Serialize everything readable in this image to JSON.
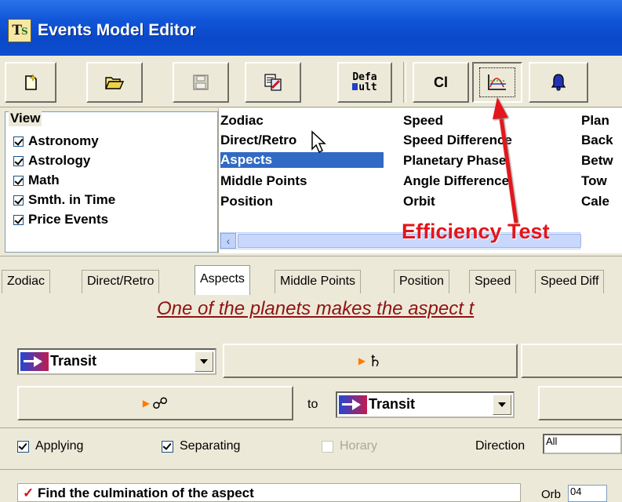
{
  "window": {
    "title": "Events Model Editor",
    "icon_text": "TS"
  },
  "toolbar": {
    "buttons": [
      {
        "name": "new-icon"
      },
      {
        "name": "open-folder-icon"
      },
      {
        "name": "save-icon"
      },
      {
        "name": "copy-icon"
      },
      {
        "name": "default-button",
        "label_top": "Defa",
        "label_bottom": "ult"
      },
      {
        "name": "cl-button",
        "label": "Cl"
      },
      {
        "name": "efficiency-test-icon"
      },
      {
        "name": "bell-icon"
      }
    ]
  },
  "view": {
    "legend": "View",
    "items": [
      {
        "label": "Astronomy",
        "checked": true
      },
      {
        "label": "Astrology",
        "checked": true
      },
      {
        "label": "Math",
        "checked": true
      },
      {
        "label": "Smth. in Time",
        "checked": true
      },
      {
        "label": "Price Events",
        "checked": true
      }
    ]
  },
  "event_list": {
    "col1": [
      "Zodiac",
      "Direct/Retro",
      "Aspects",
      "Middle Points",
      "Position"
    ],
    "col2": [
      "Speed",
      "Speed Difference",
      "Planetary Phase",
      "Angle Difference",
      "Orbit"
    ],
    "col3": [
      "Plan",
      "Back",
      "Betw",
      "Tow",
      "Cale"
    ],
    "selected": "Aspects"
  },
  "annotation": {
    "text": "Efficiency Test",
    "color": "#e3151a"
  },
  "tabs": [
    "Zodiac",
    "Direct/Retro",
    "Aspects",
    "Middle Points",
    "Position",
    "Speed",
    "Speed Diff"
  ],
  "active_tab": "Aspects",
  "aspect_panel": {
    "headline": "One of the planets makes  the aspect t",
    "transit_combo_1": "Transit",
    "planet_1_glyph": "♄",
    "planet_2_glyph": "☍",
    "to_label": "to",
    "transit_combo_2": "Transit",
    "applying": {
      "label": "Applying",
      "checked": true
    },
    "separating": {
      "label": "Separating",
      "checked": true
    },
    "horary": {
      "label": "Horary",
      "checked": false,
      "disabled": true
    },
    "direction_label": "Direction",
    "direction_value": "All",
    "bottom_text": "Find the culmination of the aspect",
    "orb_label": "Orb",
    "orb_value": "04"
  }
}
